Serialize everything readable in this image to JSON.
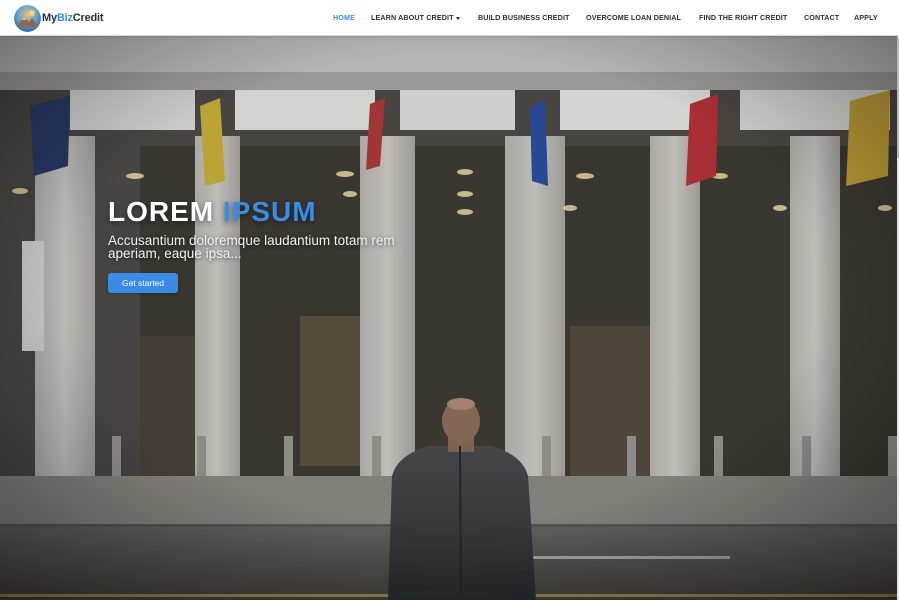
{
  "brand": {
    "part1": "My",
    "part2": "Biz",
    "part3": "Credit",
    "logo_icon": "mountain-sun-logo-icon"
  },
  "nav": {
    "items": [
      {
        "label": "HOME",
        "active": true
      },
      {
        "label": "LEARN ABOUT CREDIT",
        "dropdown": true
      },
      {
        "label": "BUILD BUSINESS CREDIT"
      },
      {
        "label": "OVERCOME LOAN DENIAL"
      },
      {
        "label": "FIND THE RIGHT CREDIT"
      },
      {
        "label": "CONTACT"
      },
      {
        "label": "APPLY"
      }
    ]
  },
  "hero": {
    "title_main": "LOREM",
    "title_accent": "IPSUM",
    "subtitle": "Accusantium doloremque laudantium totam rem aperiam, eaque ipsa...",
    "cta_label": "Get started",
    "background": "photo-businessman-building-entrance"
  },
  "colors": {
    "accent": "#3a8be6",
    "nav_text": "#2b2f36",
    "navbar_bg": "#ffffff"
  }
}
